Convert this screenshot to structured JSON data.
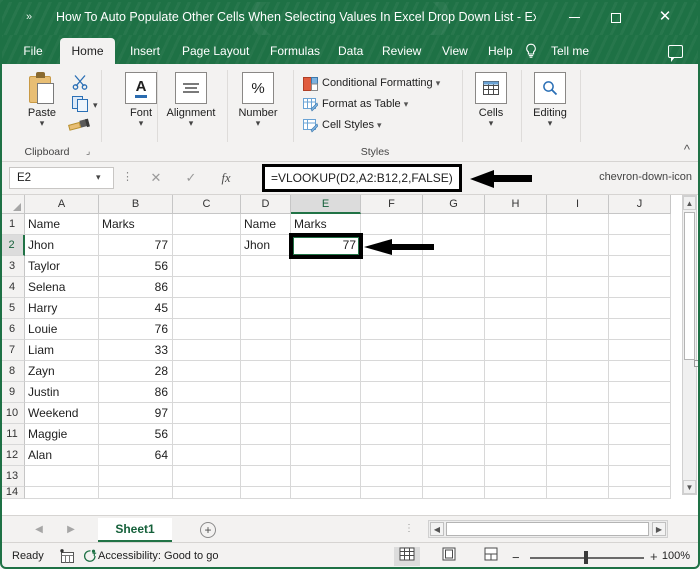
{
  "window": {
    "title": "How To Auto Populate Other Cells When Selecting Values In Excel Drop Down List  -  Excel",
    "qat_icon": "chevron-double-right",
    "minimize": "minimize",
    "maximize": "maximize",
    "close": "✕"
  },
  "ribbon_tabs": [
    {
      "label": "File",
      "active": false
    },
    {
      "label": "Home",
      "active": true
    },
    {
      "label": "Insert",
      "active": false
    },
    {
      "label": "Page Layout",
      "active": false
    },
    {
      "label": "Formulas",
      "active": false
    },
    {
      "label": "Data",
      "active": false
    },
    {
      "label": "Review",
      "active": false
    },
    {
      "label": "View",
      "active": false
    },
    {
      "label": "Help",
      "active": false
    },
    {
      "label": "Tell me",
      "active": false
    }
  ],
  "ribbon": {
    "clipboard": {
      "group_label": "Clipboard",
      "paste_label": "Paste",
      "cut_icon": "scissors-icon",
      "copy_icon": "copy-icon",
      "format_painter_icon": "format-painter-icon",
      "launcher_icon": "dialog-launcher-icon"
    },
    "font": {
      "label": "Font"
    },
    "alignment": {
      "label": "Alignment"
    },
    "number": {
      "label": "Number",
      "symbol": "%"
    },
    "styles": {
      "group_label": "Styles",
      "items": [
        {
          "label": "Conditional Formatting"
        },
        {
          "label": "Format as Table"
        },
        {
          "label": "Cell Styles"
        }
      ]
    },
    "cells": {
      "label": "Cells"
    },
    "editing": {
      "label": "Editing"
    },
    "collapse_icon": "chevron-up-icon"
  },
  "formula_bar": {
    "name_box": "E2",
    "cancel_icon": "✕",
    "enter_icon": "✓",
    "function_icon": "fx",
    "formula": "=VLOOKUP(D2,A2:B12,2,FALSE)",
    "expand_icon": "chevron-down-icon",
    "highlight_color": "#000000"
  },
  "grid": {
    "columns": [
      "A",
      "B",
      "C",
      "D",
      "E",
      "F",
      "G",
      "H",
      "I",
      "J"
    ],
    "selected_column": "E",
    "selected_row": 2,
    "rows": [
      1,
      2,
      3,
      4,
      5,
      6,
      7,
      8,
      9,
      10,
      11,
      12,
      13,
      14
    ],
    "cells": [
      {
        "row": 1,
        "A": "Name",
        "B": "Marks",
        "C": "",
        "D": "Name",
        "E": "Marks"
      },
      {
        "row": 2,
        "A": "Jhon",
        "B": "77",
        "C": "",
        "D": "Jhon",
        "E": "77"
      },
      {
        "row": 3,
        "A": "Taylor",
        "B": "56",
        "C": "",
        "D": "",
        "E": ""
      },
      {
        "row": 4,
        "A": "Selena",
        "B": "86",
        "C": "",
        "D": "",
        "E": ""
      },
      {
        "row": 5,
        "A": "Harry",
        "B": "45",
        "C": "",
        "D": "",
        "E": ""
      },
      {
        "row": 6,
        "A": "Louie",
        "B": "76",
        "C": "",
        "D": "",
        "E": ""
      },
      {
        "row": 7,
        "A": "Liam",
        "B": "33",
        "C": "",
        "D": "",
        "E": ""
      },
      {
        "row": 8,
        "A": "Zayn",
        "B": "28",
        "C": "",
        "D": "",
        "E": ""
      },
      {
        "row": 9,
        "A": "Justin",
        "B": "86",
        "C": "",
        "D": "",
        "E": ""
      },
      {
        "row": 10,
        "A": "Weekend",
        "B": "97",
        "C": "",
        "D": "",
        "E": ""
      },
      {
        "row": 11,
        "A": "Maggie",
        "B": "56",
        "C": "",
        "D": "",
        "E": ""
      },
      {
        "row": 12,
        "A": "Alan",
        "B": "64",
        "C": "",
        "D": "",
        "E": ""
      },
      {
        "row": 13,
        "A": "",
        "B": "",
        "C": "",
        "D": "",
        "E": ""
      },
      {
        "row": 14,
        "A": "",
        "B": "",
        "C": "",
        "D": "",
        "E": ""
      }
    ],
    "active_cell": {
      "ref": "E2",
      "value": "77"
    }
  },
  "annotations": [
    {
      "name": "formula-bar-arrow",
      "points_to": "formula-bar"
    },
    {
      "name": "cell-value-arrow",
      "points_to": "cell-E2"
    }
  ],
  "sheet_bar": {
    "prev_icon": "chevron-left-icon",
    "next_icon": "chevron-right-icon",
    "sheets": [
      {
        "label": "Sheet1",
        "active": true
      }
    ],
    "add_sheet_icon": "plus-icon"
  },
  "status_bar": {
    "state": "Ready",
    "macro_icon": "record-macro-icon",
    "accessibility": "Accessibility: Good to go",
    "views": [
      {
        "name": "normal-view",
        "active": true
      },
      {
        "name": "page-layout-view",
        "active": false
      },
      {
        "name": "page-break-view",
        "active": false
      }
    ],
    "zoom_out": "−",
    "zoom_in": "+",
    "zoom_level": "100%"
  },
  "theme": {
    "excel_green": "#1e7145",
    "ribbon_bg": "#f3f2f1",
    "accent_green": "#217346"
  }
}
